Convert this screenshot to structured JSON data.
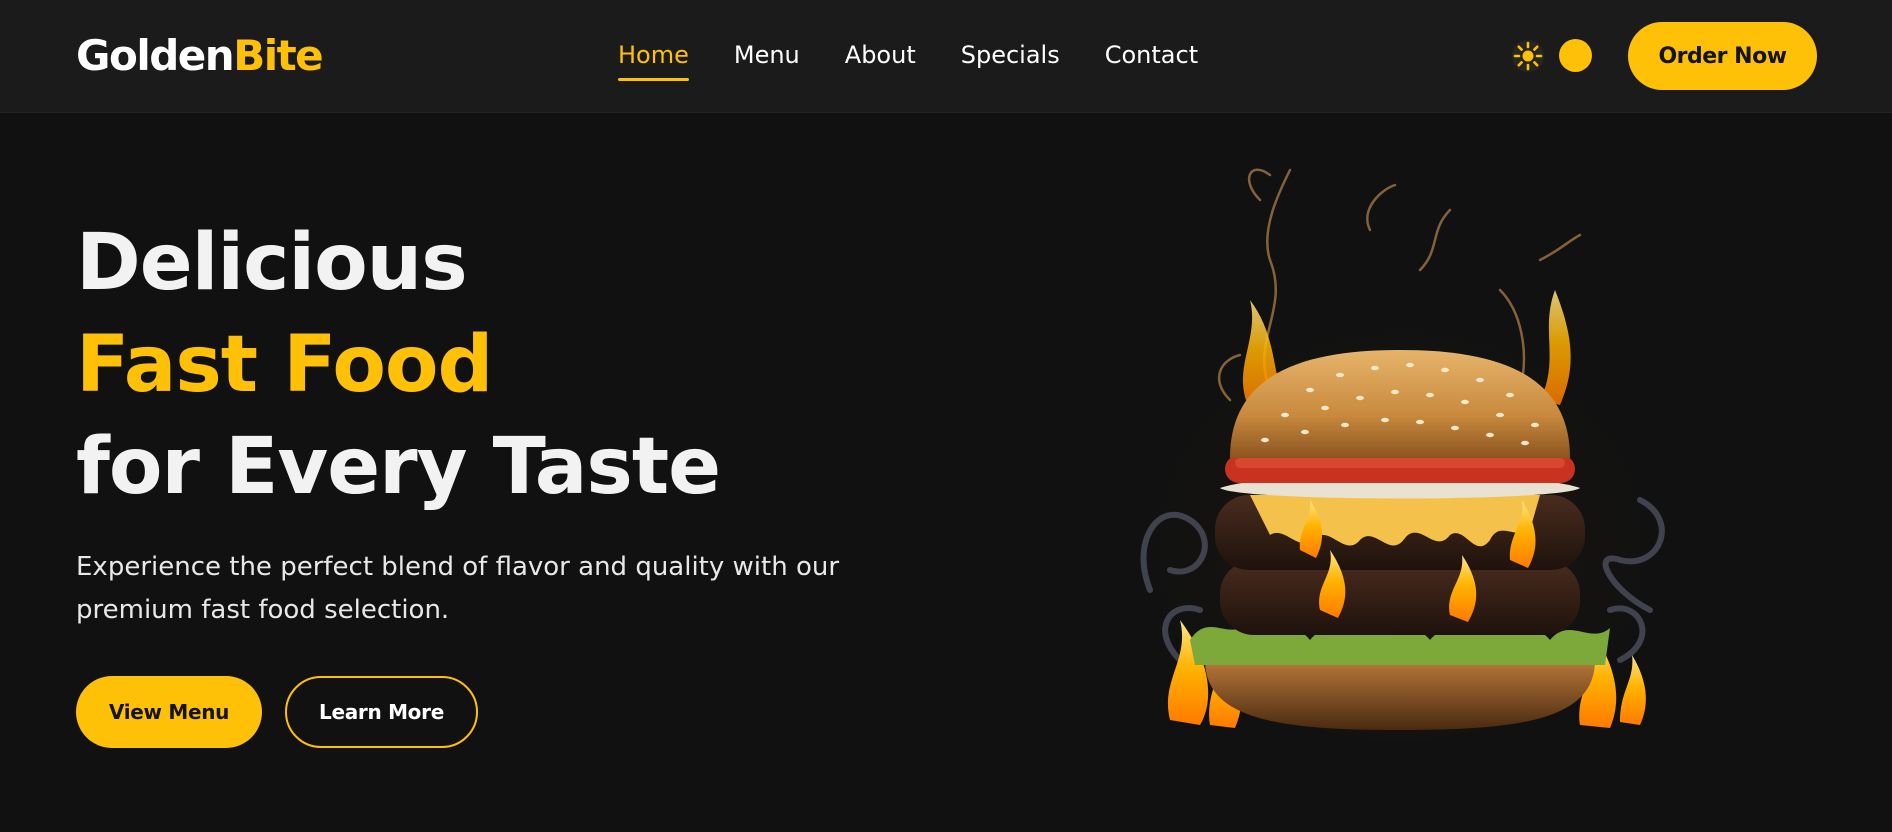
{
  "brand": {
    "name_part1": "Golden",
    "name_part2": "Bite",
    "accent_color": "#FFC107",
    "background_color": "#111111"
  },
  "nav": {
    "items": [
      {
        "label": "Home",
        "active": true
      },
      {
        "label": "Menu",
        "active": false
      },
      {
        "label": "About",
        "active": false
      },
      {
        "label": "Specials",
        "active": false
      },
      {
        "label": "Contact",
        "active": false
      }
    ]
  },
  "header": {
    "theme_toggle_icon": "sun-icon",
    "order_button_label": "Order Now"
  },
  "hero": {
    "title_line1": "Delicious",
    "title_line2": "Fast Food",
    "title_line3": "for Every Taste",
    "description": "Experience the perfect blend of flavor and quality with our premium fast food selection.",
    "primary_button_label": "View Menu",
    "secondary_button_label": "Learn More",
    "image_icon": "burger-image"
  }
}
